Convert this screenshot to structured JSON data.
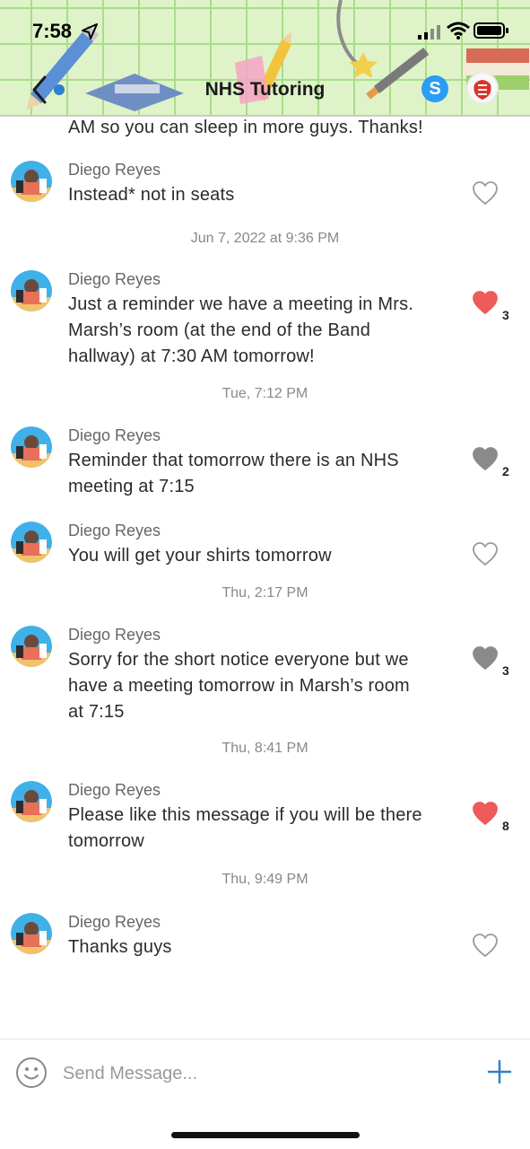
{
  "status_bar": {
    "time": "7:58"
  },
  "header": {
    "title": "NHS Tutoring",
    "skype_letter": "S"
  },
  "thread": {
    "partial_message": "AM so you can sleep in more guys. Thanks!",
    "items": [
      {
        "kind": "message",
        "sender": "Diego Reyes",
        "lines": [
          "Instead* not in seats"
        ],
        "liked": false,
        "like_color": "outline",
        "like_count": ""
      },
      {
        "kind": "timestamp",
        "text": "Jun 7, 2022 at 9:36 PM"
      },
      {
        "kind": "message",
        "sender": "Diego Reyes",
        "lines": [
          "Just a reminder we have a meeting in Mrs.",
          "Marsh’s room (at the end of the Band",
          "hallway) at 7:30 AM tomorrow!"
        ],
        "liked": true,
        "like_color": "#ef5a5a",
        "like_count": "3"
      },
      {
        "kind": "timestamp",
        "text": "Tue, 7:12 PM"
      },
      {
        "kind": "message",
        "sender": "Diego Reyes",
        "lines": [
          "Reminder that tomorrow there is an NHS",
          "meeting at 7:15"
        ],
        "liked": true,
        "like_color": "#8a8a8a",
        "like_count": "2"
      },
      {
        "kind": "message",
        "sender": "Diego Reyes",
        "lines": [
          "You will get your shirts tomorrow"
        ],
        "liked": false,
        "like_color": "outline",
        "like_count": ""
      },
      {
        "kind": "timestamp",
        "text": "Thu, 2:17 PM"
      },
      {
        "kind": "message",
        "sender": "Diego Reyes",
        "lines": [
          "Sorry for the short notice everyone but we",
          "have a meeting tomorrow in Marsh’s room",
          "at 7:15"
        ],
        "liked": true,
        "like_color": "#8a8a8a",
        "like_count": "3"
      },
      {
        "kind": "timestamp",
        "text": "Thu, 8:41 PM"
      },
      {
        "kind": "message",
        "sender": "Diego Reyes",
        "lines": [
          "Please like this message if you will be there",
          "tomorrow"
        ],
        "liked": true,
        "like_color": "#ef5a5a",
        "like_count": "8"
      },
      {
        "kind": "timestamp",
        "text": "Thu, 9:49 PM"
      },
      {
        "kind": "message",
        "sender": "Diego Reyes",
        "lines": [
          "Thanks guys"
        ],
        "liked": false,
        "like_color": "outline",
        "like_count": ""
      }
    ]
  },
  "input": {
    "placeholder": "Send Message..."
  },
  "icons": {
    "back": "chevron-left-icon",
    "emoji": "smiley-icon",
    "add": "plus-icon",
    "like": "heart-icon"
  },
  "colors": {
    "accent_blue": "#2f7fd0",
    "heart_red": "#ef5a5a",
    "heart_gray": "#8a8a8a",
    "header_green": "#dff3c9"
  }
}
